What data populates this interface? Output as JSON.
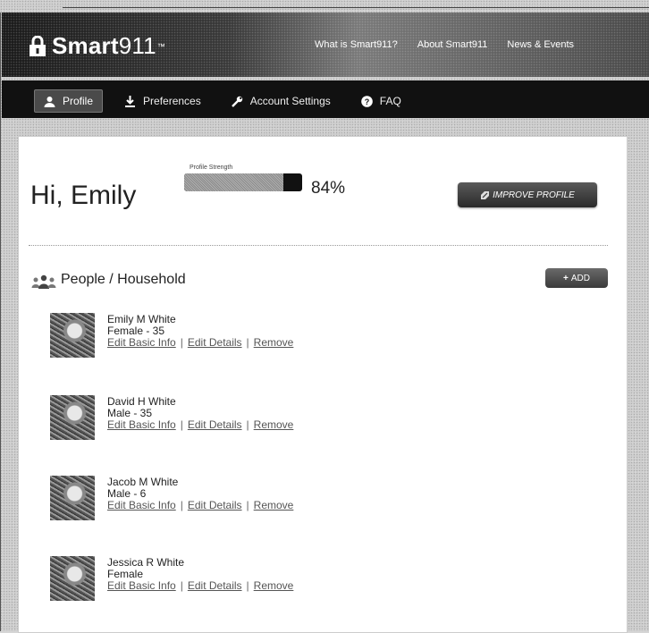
{
  "brand": {
    "bold": "Smart",
    "thin": "911",
    "mark": "™"
  },
  "topnav": [
    "What is Smart911?",
    "About Smart911",
    "News & Events"
  ],
  "nav": [
    {
      "label": "Profile",
      "icon": "user-icon",
      "active": true
    },
    {
      "label": "Preferences",
      "icon": "download-icon",
      "active": false
    },
    {
      "label": "Account Settings",
      "icon": "wrench-icon",
      "active": false
    },
    {
      "label": "FAQ",
      "icon": "question-icon",
      "active": false
    }
  ],
  "profile": {
    "greeting": "Hi, Emily",
    "strength_label": "Profile Strength",
    "strength_value": "84%",
    "strength_fraction": 0.84,
    "improve_label": "IMPROVE PROFILE"
  },
  "section": {
    "title": "People / Household",
    "add_label": "ADD"
  },
  "links": {
    "basic": "Edit Basic Info",
    "details": "Edit Details",
    "remove": "Remove",
    "sep": "|"
  },
  "people": [
    {
      "name": "Emily M White",
      "detail": "Female - 35"
    },
    {
      "name": "David H White",
      "detail": "Male - 35"
    },
    {
      "name": "Jacob M White",
      "detail": "Male - 6"
    },
    {
      "name": "Jessica R White",
      "detail": "Female"
    }
  ]
}
